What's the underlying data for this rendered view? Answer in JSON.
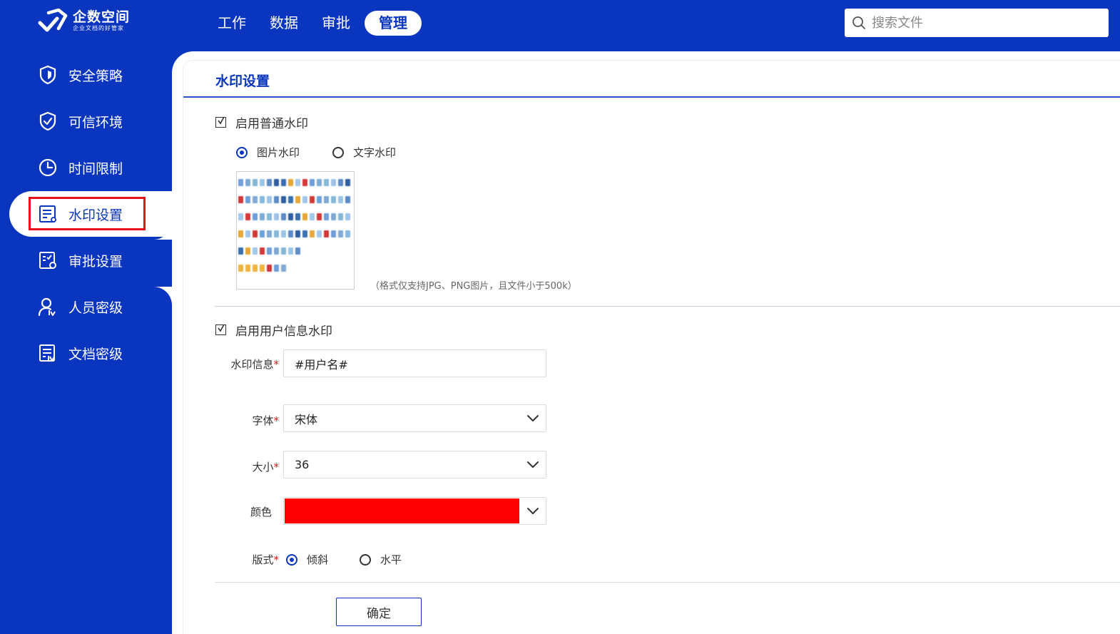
{
  "app": {
    "logo_title": "企数空间",
    "logo_subtitle": "企业文档的好管家"
  },
  "nav": {
    "items": [
      {
        "label": "工作",
        "active": false
      },
      {
        "label": "数据",
        "active": false
      },
      {
        "label": "审批",
        "active": false
      },
      {
        "label": "管理",
        "active": true
      }
    ]
  },
  "search": {
    "placeholder": "搜索文件",
    "icon": "search-icon"
  },
  "sidebar": {
    "items": [
      {
        "label": "安全策略",
        "icon": "shield-icon",
        "active": false
      },
      {
        "label": "可信环境",
        "icon": "shield-check-icon",
        "active": false
      },
      {
        "label": "时间限制",
        "icon": "clock-icon",
        "active": false
      },
      {
        "label": "水印设置",
        "icon": "watermark-doc-icon",
        "active": true
      },
      {
        "label": "审批设置",
        "icon": "approval-doc-icon",
        "active": false
      },
      {
        "label": "人员密级",
        "icon": "user-level-icon",
        "active": false
      },
      {
        "label": "文档密级",
        "icon": "doc-level-icon",
        "active": false
      }
    ]
  },
  "panel": {
    "title": "水印设置",
    "normal_watermark": {
      "label": "启用普通水印",
      "checked": true,
      "options": [
        {
          "label": "图片水印",
          "selected": true
        },
        {
          "label": "文字水印",
          "selected": false
        }
      ],
      "hint": "（格式仅支持JPG、PNG图片，且文件小于500k）"
    },
    "user_watermark": {
      "label": "启用用户信息水印",
      "checked": true
    },
    "form": {
      "info_label": "水印信息",
      "info_value": "#用户名#",
      "font_label": "字体",
      "font_value": "宋体",
      "size_label": "大小",
      "size_value": "36",
      "color_label": "颜色",
      "color_value": "#fe0000",
      "layout_label": "版式",
      "layout_options": [
        {
          "label": "倾斜",
          "selected": true
        },
        {
          "label": "水平",
          "selected": false
        }
      ],
      "required_mark": "*"
    },
    "confirm_label": "确定"
  },
  "colors": {
    "brand": "#0a36bf",
    "highlight": "#e8101a"
  }
}
